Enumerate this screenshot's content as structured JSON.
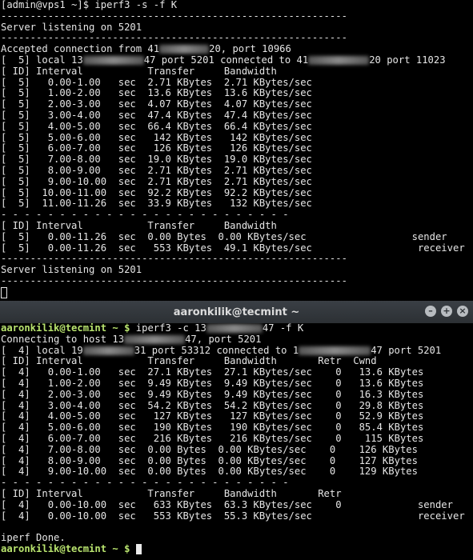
{
  "server_terminal": {
    "prompt": "[admin@vps1 ~]$ ",
    "command": "iperf3 -s -f K",
    "divider": "-----------------------------------------------------------",
    "listening": "Server listening on 5201",
    "accepted_a": "Accepted connection from 41",
    "accepted_b": "20, port 10966",
    "local_a": "[  5] local 13",
    "local_b": "47 port 5201 connected to 41",
    "local_c": "20 port 11023",
    "header": "[ ID] Interval           Transfer     Bandwidth",
    "rows": [
      "[  5]   0.00-1.00   sec  2.71 KBytes  2.71 KBytes/sec",
      "[  5]   1.00-2.00   sec  13.6 KBytes  13.6 KBytes/sec",
      "[  5]   2.00-3.00   sec  4.07 KBytes  4.07 KBytes/sec",
      "[  5]   3.00-4.00   sec  47.4 KBytes  47.4 KBytes/sec",
      "[  5]   4.00-5.00   sec  66.4 KBytes  66.4 KBytes/sec",
      "[  5]   5.00-6.00   sec   142 KBytes   142 KBytes/sec",
      "[  5]   6.00-7.00   sec   126 KBytes   126 KBytes/sec",
      "[  5]   7.00-8.00   sec  19.0 KBytes  19.0 KBytes/sec",
      "[  5]   8.00-9.00   sec  2.71 KBytes  2.71 KBytes/sec",
      "[  5]   9.00-10.00  sec  2.71 KBytes  2.71 KBytes/sec",
      "[  5]  10.00-11.00  sec  92.2 KBytes  92.2 KBytes/sec",
      "[  5]  11.00-11.26  sec  33.9 KBytes   132 KBytes/sec"
    ],
    "dash_divider": "- - - - - - - - - - - - - - - - - - - - - - - - -",
    "summary_header": "[ ID] Interval           Transfer     Bandwidth",
    "summary_rows": [
      "[  5]   0.00-11.26  sec  0.00 Bytes  0.00 KBytes/sec                  sender",
      "[  5]   0.00-11.26  sec   553 KBytes  49.1 KBytes/sec                  receiver"
    ],
    "listening_again": "Server listening on 5201"
  },
  "client_window": {
    "title": "aaronkilik@tecmint ~",
    "minimize_label": "–",
    "maximize_label": "+",
    "close_label": "×",
    "prompt_user": "aaronkilik@tecmint",
    "prompt_suffix": " ~ $ ",
    "command_a": "iperf3 -c 13",
    "command_b": "47 -f K",
    "connecting_a": "Connecting to host 13",
    "connecting_b": "47, port 5201",
    "local_a": "[  4] local 19",
    "local_b": "31 port 53312 connected to 1",
    "local_c": "47 port 5201",
    "header": "[ ID] Interval           Transfer     Bandwidth       Retr  Cwnd",
    "rows": [
      "[  4]   0.00-1.00   sec  27.1 KBytes  27.1 KBytes/sec    0   13.6 KBytes",
      "[  4]   1.00-2.00   sec  9.49 KBytes  9.49 KBytes/sec    0   13.6 KBytes",
      "[  4]   2.00-3.00   sec  9.49 KBytes  9.49 KBytes/sec    0   16.3 KBytes",
      "[  4]   3.00-4.00   sec  54.2 KBytes  54.2 KBytes/sec    0   29.8 KBytes",
      "[  4]   4.00-5.00   sec   127 KBytes   127 KBytes/sec    0   52.9 KBytes",
      "[  4]   5.00-6.00   sec   190 KBytes   190 KBytes/sec    0   85.4 KBytes",
      "[  4]   6.00-7.00   sec   216 KBytes   216 KBytes/sec    0    115 KBytes",
      "[  4]   7.00-8.00   sec  0.00 Bytes  0.00 KBytes/sec    0    126 KBytes",
      "[  4]   8.00-9.00   sec  0.00 Bytes  0.00 KBytes/sec    0    127 KBytes",
      "[  4]   9.00-10.00  sec  0.00 Bytes  0.00 KBytes/sec    0    129 KBytes"
    ],
    "dash_divider": "- - - - - - - - - - - - - - - - - - - - - - - - -",
    "summary_header": "[ ID] Interval           Transfer     Bandwidth       Retr",
    "summary_rows": [
      "[  4]   0.00-10.00  sec   633 KBytes  63.3 KBytes/sec    0             sender",
      "[  4]   0.00-10.00  sec   553 KBytes  55.3 KBytes/sec                  receiver"
    ],
    "done": "iperf Done."
  }
}
